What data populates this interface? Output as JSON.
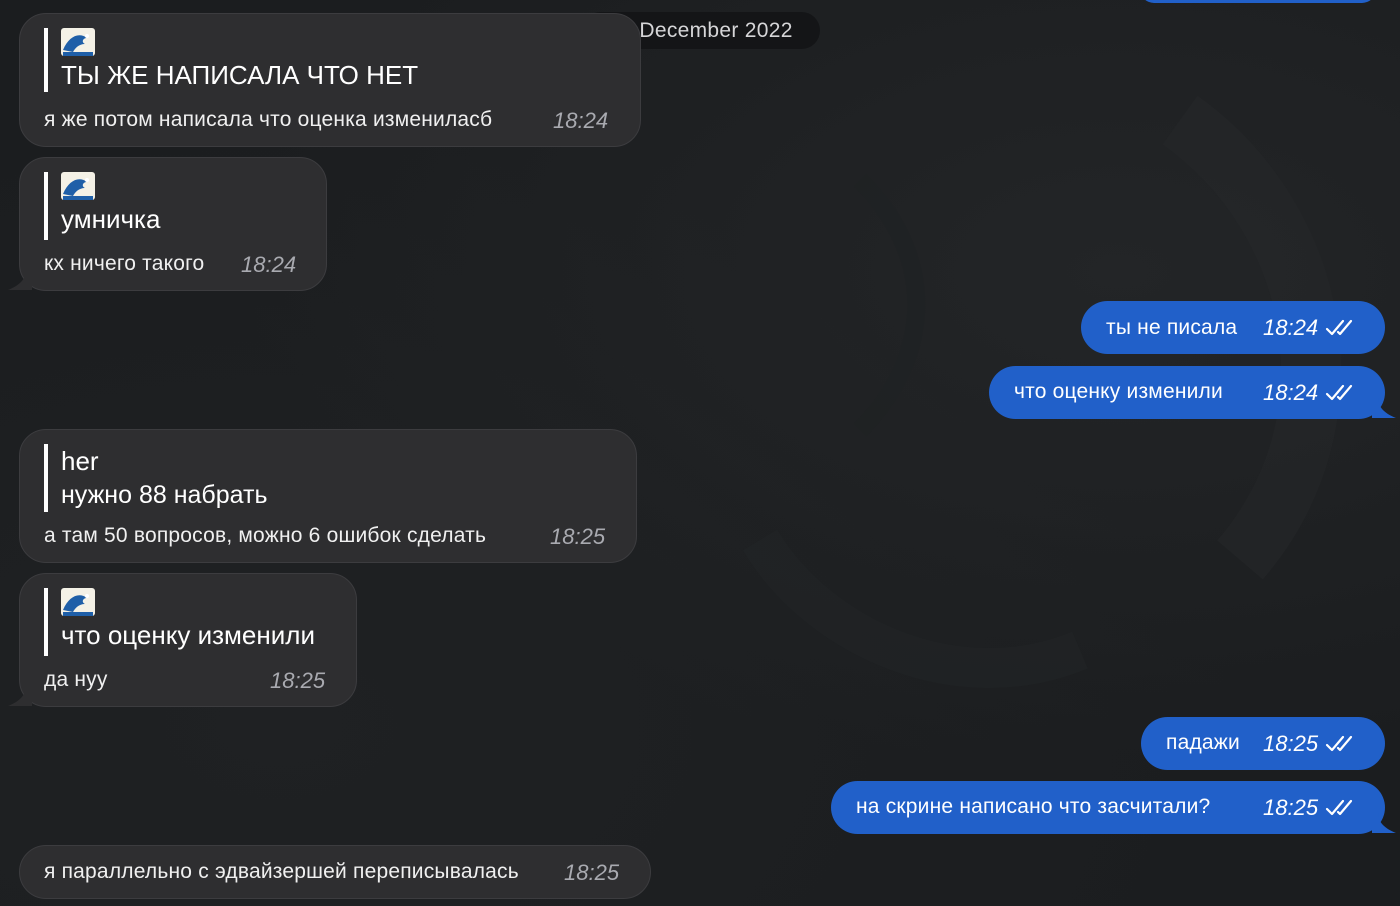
{
  "chat": {
    "date_label": "29 December 2022",
    "messages": [
      {
        "direction": "incoming",
        "quote_icon": "ocean-wave-emoji",
        "quote_text": "ТЫ ЖЕ НАПИСАЛА ЧТО НЕТ",
        "text": "я же потом написала что оценка измениласб",
        "time": "18:24"
      },
      {
        "direction": "incoming",
        "quote_icon": "ocean-wave-emoji",
        "quote_text": "умничка",
        "text": "кх ничего такого",
        "time": "18:24"
      },
      {
        "direction": "outgoing",
        "text": "ты не писала",
        "time": "18:24",
        "status": "read"
      },
      {
        "direction": "outgoing",
        "text": "что оценку изменили",
        "time": "18:24",
        "status": "read"
      },
      {
        "direction": "incoming",
        "quote_title": "her",
        "quote_text": "нужно 88 набрать",
        "text": "а там 50 вопросов, можно 6 ошибок сделать",
        "time": "18:25"
      },
      {
        "direction": "incoming",
        "quote_icon": "ocean-wave-emoji",
        "quote_text": "что оценку изменили",
        "text": "да нуу",
        "time": "18:25"
      },
      {
        "direction": "outgoing",
        "text": "падажи",
        "time": "18:25",
        "status": "read"
      },
      {
        "direction": "outgoing",
        "text": "на скрине написано что засчитали?",
        "time": "18:25",
        "status": "read"
      },
      {
        "direction": "incoming",
        "text": "я параллельно с эдвайзершей переписывалась",
        "time": "18:25"
      }
    ]
  },
  "colors": {
    "background": "#1b1d1f",
    "incoming_bubble": "#2e2e30",
    "outgoing_bubble": "#2160c9",
    "date_pill": "#141517"
  }
}
